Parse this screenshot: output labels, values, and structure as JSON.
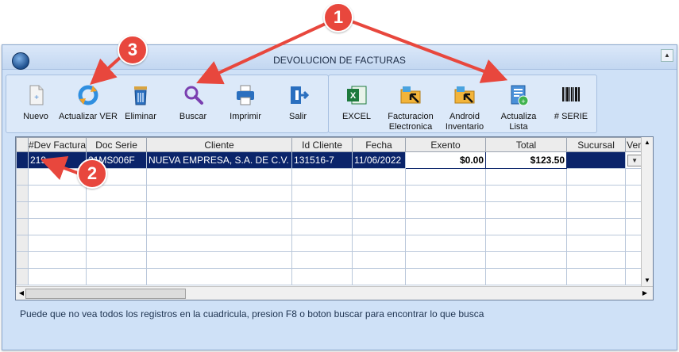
{
  "window": {
    "title": "DEVOLUCION DE FACTURAS"
  },
  "toolbar_left": [
    {
      "label": "Nuevo",
      "icon": "new-document-icon"
    },
    {
      "label": "Actualizar VER",
      "icon": "refresh-icon"
    },
    {
      "label": "Eliminar",
      "icon": "trash-icon"
    },
    {
      "label": "Buscar",
      "icon": "search-icon"
    },
    {
      "label": "Imprimir",
      "icon": "printer-icon"
    },
    {
      "label": "Salir",
      "icon": "exit-icon"
    }
  ],
  "toolbar_right": [
    {
      "label": "EXCEL",
      "icon": "excel-icon"
    },
    {
      "label": "Facturacion Electronica",
      "icon": "folder-arrow-icon"
    },
    {
      "label": "Android Inventario",
      "icon": "folder-arrow-icon"
    },
    {
      "label": "Actualiza Lista",
      "icon": "list-update-icon"
    },
    {
      "label": "# SERIE",
      "icon": "barcode-icon"
    }
  ],
  "grid": {
    "columns": [
      "#Dev Factura",
      "Doc Serie",
      "Cliente",
      "Id Cliente",
      "Fecha",
      "Exento",
      "Total",
      "Sucursal",
      "Ven"
    ],
    "rows": [
      [
        "219",
        "21MS006F",
        "NUEVA EMPRESA, S.A. DE C.V.",
        "131516-7",
        "11/06/2022",
        "$0.00",
        "$123.50",
        "",
        ""
      ]
    ]
  },
  "status_text": "Puede que no vea todos los registros en la cuadricula, presion F8 o boton buscar para encontrar lo que busca",
  "annotations": {
    "badge_1": "1",
    "badge_2": "2",
    "badge_3": "3",
    "color": "#e8473d"
  }
}
